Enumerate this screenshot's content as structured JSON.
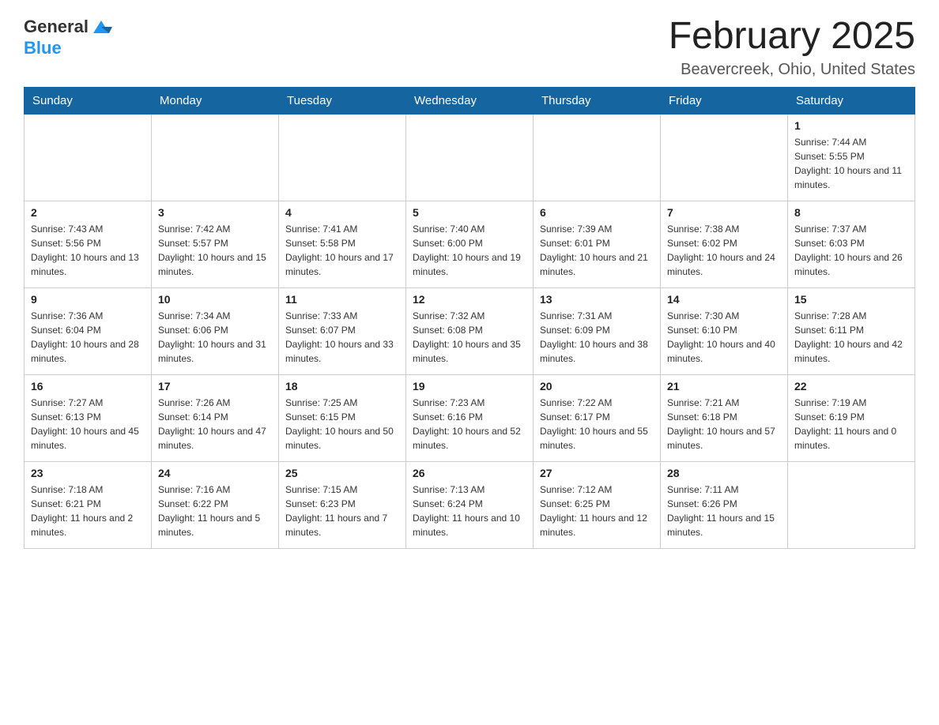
{
  "header": {
    "logo": {
      "text_general": "General",
      "text_blue": "Blue",
      "icon_alt": "GeneralBlue logo"
    },
    "title": "February 2025",
    "location": "Beavercreek, Ohio, United States"
  },
  "weekdays": [
    "Sunday",
    "Monday",
    "Tuesday",
    "Wednesday",
    "Thursday",
    "Friday",
    "Saturday"
  ],
  "weeks": [
    [
      {
        "day": "",
        "sunrise": "",
        "sunset": "",
        "daylight": ""
      },
      {
        "day": "",
        "sunrise": "",
        "sunset": "",
        "daylight": ""
      },
      {
        "day": "",
        "sunrise": "",
        "sunset": "",
        "daylight": ""
      },
      {
        "day": "",
        "sunrise": "",
        "sunset": "",
        "daylight": ""
      },
      {
        "day": "",
        "sunrise": "",
        "sunset": "",
        "daylight": ""
      },
      {
        "day": "",
        "sunrise": "",
        "sunset": "",
        "daylight": ""
      },
      {
        "day": "1",
        "sunrise": "Sunrise: 7:44 AM",
        "sunset": "Sunset: 5:55 PM",
        "daylight": "Daylight: 10 hours and 11 minutes."
      }
    ],
    [
      {
        "day": "2",
        "sunrise": "Sunrise: 7:43 AM",
        "sunset": "Sunset: 5:56 PM",
        "daylight": "Daylight: 10 hours and 13 minutes."
      },
      {
        "day": "3",
        "sunrise": "Sunrise: 7:42 AM",
        "sunset": "Sunset: 5:57 PM",
        "daylight": "Daylight: 10 hours and 15 minutes."
      },
      {
        "day": "4",
        "sunrise": "Sunrise: 7:41 AM",
        "sunset": "Sunset: 5:58 PM",
        "daylight": "Daylight: 10 hours and 17 minutes."
      },
      {
        "day": "5",
        "sunrise": "Sunrise: 7:40 AM",
        "sunset": "Sunset: 6:00 PM",
        "daylight": "Daylight: 10 hours and 19 minutes."
      },
      {
        "day": "6",
        "sunrise": "Sunrise: 7:39 AM",
        "sunset": "Sunset: 6:01 PM",
        "daylight": "Daylight: 10 hours and 21 minutes."
      },
      {
        "day": "7",
        "sunrise": "Sunrise: 7:38 AM",
        "sunset": "Sunset: 6:02 PM",
        "daylight": "Daylight: 10 hours and 24 minutes."
      },
      {
        "day": "8",
        "sunrise": "Sunrise: 7:37 AM",
        "sunset": "Sunset: 6:03 PM",
        "daylight": "Daylight: 10 hours and 26 minutes."
      }
    ],
    [
      {
        "day": "9",
        "sunrise": "Sunrise: 7:36 AM",
        "sunset": "Sunset: 6:04 PM",
        "daylight": "Daylight: 10 hours and 28 minutes."
      },
      {
        "day": "10",
        "sunrise": "Sunrise: 7:34 AM",
        "sunset": "Sunset: 6:06 PM",
        "daylight": "Daylight: 10 hours and 31 minutes."
      },
      {
        "day": "11",
        "sunrise": "Sunrise: 7:33 AM",
        "sunset": "Sunset: 6:07 PM",
        "daylight": "Daylight: 10 hours and 33 minutes."
      },
      {
        "day": "12",
        "sunrise": "Sunrise: 7:32 AM",
        "sunset": "Sunset: 6:08 PM",
        "daylight": "Daylight: 10 hours and 35 minutes."
      },
      {
        "day": "13",
        "sunrise": "Sunrise: 7:31 AM",
        "sunset": "Sunset: 6:09 PM",
        "daylight": "Daylight: 10 hours and 38 minutes."
      },
      {
        "day": "14",
        "sunrise": "Sunrise: 7:30 AM",
        "sunset": "Sunset: 6:10 PM",
        "daylight": "Daylight: 10 hours and 40 minutes."
      },
      {
        "day": "15",
        "sunrise": "Sunrise: 7:28 AM",
        "sunset": "Sunset: 6:11 PM",
        "daylight": "Daylight: 10 hours and 42 minutes."
      }
    ],
    [
      {
        "day": "16",
        "sunrise": "Sunrise: 7:27 AM",
        "sunset": "Sunset: 6:13 PM",
        "daylight": "Daylight: 10 hours and 45 minutes."
      },
      {
        "day": "17",
        "sunrise": "Sunrise: 7:26 AM",
        "sunset": "Sunset: 6:14 PM",
        "daylight": "Daylight: 10 hours and 47 minutes."
      },
      {
        "day": "18",
        "sunrise": "Sunrise: 7:25 AM",
        "sunset": "Sunset: 6:15 PM",
        "daylight": "Daylight: 10 hours and 50 minutes."
      },
      {
        "day": "19",
        "sunrise": "Sunrise: 7:23 AM",
        "sunset": "Sunset: 6:16 PM",
        "daylight": "Daylight: 10 hours and 52 minutes."
      },
      {
        "day": "20",
        "sunrise": "Sunrise: 7:22 AM",
        "sunset": "Sunset: 6:17 PM",
        "daylight": "Daylight: 10 hours and 55 minutes."
      },
      {
        "day": "21",
        "sunrise": "Sunrise: 7:21 AM",
        "sunset": "Sunset: 6:18 PM",
        "daylight": "Daylight: 10 hours and 57 minutes."
      },
      {
        "day": "22",
        "sunrise": "Sunrise: 7:19 AM",
        "sunset": "Sunset: 6:19 PM",
        "daylight": "Daylight: 11 hours and 0 minutes."
      }
    ],
    [
      {
        "day": "23",
        "sunrise": "Sunrise: 7:18 AM",
        "sunset": "Sunset: 6:21 PM",
        "daylight": "Daylight: 11 hours and 2 minutes."
      },
      {
        "day": "24",
        "sunrise": "Sunrise: 7:16 AM",
        "sunset": "Sunset: 6:22 PM",
        "daylight": "Daylight: 11 hours and 5 minutes."
      },
      {
        "day": "25",
        "sunrise": "Sunrise: 7:15 AM",
        "sunset": "Sunset: 6:23 PM",
        "daylight": "Daylight: 11 hours and 7 minutes."
      },
      {
        "day": "26",
        "sunrise": "Sunrise: 7:13 AM",
        "sunset": "Sunset: 6:24 PM",
        "daylight": "Daylight: 11 hours and 10 minutes."
      },
      {
        "day": "27",
        "sunrise": "Sunrise: 7:12 AM",
        "sunset": "Sunset: 6:25 PM",
        "daylight": "Daylight: 11 hours and 12 minutes."
      },
      {
        "day": "28",
        "sunrise": "Sunrise: 7:11 AM",
        "sunset": "Sunset: 6:26 PM",
        "daylight": "Daylight: 11 hours and 15 minutes."
      },
      {
        "day": "",
        "sunrise": "",
        "sunset": "",
        "daylight": ""
      }
    ]
  ]
}
